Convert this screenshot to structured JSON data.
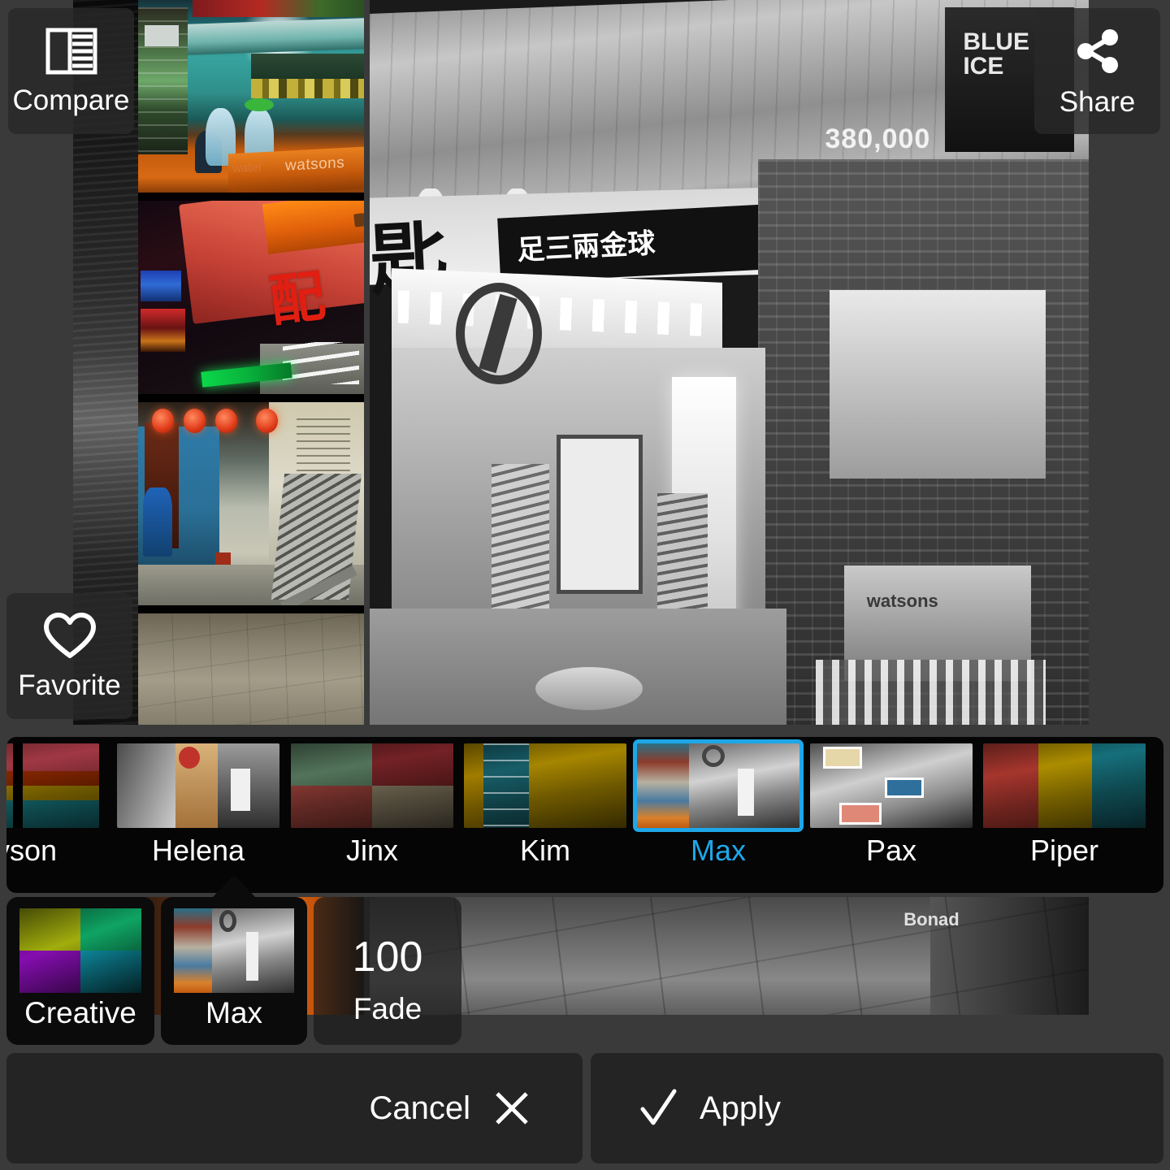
{
  "overlay_buttons": {
    "compare": {
      "label": "Compare",
      "icon": "compare-split-icon"
    },
    "share": {
      "label": "Share",
      "icon": "share-nodes-icon"
    },
    "favorite": {
      "label": "Favorite",
      "icon": "heart-outline-icon"
    }
  },
  "filter_strip": {
    "selected": "Max",
    "accent_color": "#1ea7e8",
    "items": [
      {
        "label": "ayson",
        "tint": "#d94b5e",
        "style": "quad-warm",
        "selected": false
      },
      {
        "label": "Helena",
        "tint": "#b5b5b5",
        "style": "mono-warm",
        "selected": false
      },
      {
        "label": "Jinx",
        "tint": "#c96a5a",
        "style": "quad-faded",
        "selected": false
      },
      {
        "label": "Kim",
        "tint": "#e0b400",
        "style": "split-gold",
        "selected": false
      },
      {
        "label": "Max",
        "tint": "#ffffff",
        "style": "split-mono",
        "selected": true
      },
      {
        "label": "Pax",
        "tint": "#cfcfcf",
        "style": "mono-pop",
        "selected": false
      },
      {
        "label": "Piper",
        "tint": "#e0483f",
        "style": "tri-vivid",
        "selected": false
      }
    ]
  },
  "category_buttons": [
    {
      "label": "Creative",
      "name": "creative",
      "selected": false
    },
    {
      "label": "Max",
      "name": "max",
      "selected": true
    }
  ],
  "fade_control": {
    "value": "100",
    "caption": "Fade"
  },
  "action_bar": {
    "cancel": {
      "label": "Cancel",
      "icon": "x-icon"
    },
    "apply": {
      "label": "Apply",
      "icon": "check-icon"
    }
  },
  "photo": {
    "main_is_grayscale": true,
    "collage_panels": 4,
    "ad_text_1": "380,000",
    "ad_brand": "BLUE ICE",
    "crate_brand": "watsons",
    "box_brand": "watsons",
    "box_brand_2": "water",
    "banner_text": "足三兩金球",
    "big_char": "匙",
    "sign_chars": "配匙",
    "bottom_label": "Bonad"
  }
}
